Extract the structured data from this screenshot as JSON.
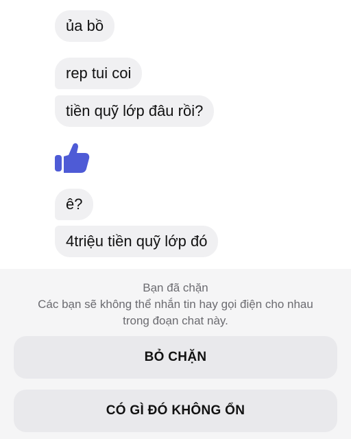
{
  "messages": [
    {
      "text": "ủa bồ"
    },
    {
      "text": "rep tui coi"
    },
    {
      "text": "tiền quỹ lớp đâu rồi?"
    },
    {
      "type": "like",
      "icon": "thumbs-up-icon"
    },
    {
      "text": "ê?"
    },
    {
      "text": "4triệu tiền quỹ lớp đó"
    }
  ],
  "block_notice": {
    "title": "Bạn đã chặn",
    "description": "Các bạn sẽ không thể nhắn tin hay gọi điện cho nhau trong đoạn chat này."
  },
  "actions": {
    "unblock_label": "BỎ CHẶN",
    "report_label": "CÓ GÌ ĐÓ KHÔNG ỔN"
  },
  "colors": {
    "like_blue": "#4e5bd6",
    "bubble_bg": "#f0f0f2",
    "panel_bg": "#f5f5f6",
    "muted_text": "#6b6b70"
  }
}
